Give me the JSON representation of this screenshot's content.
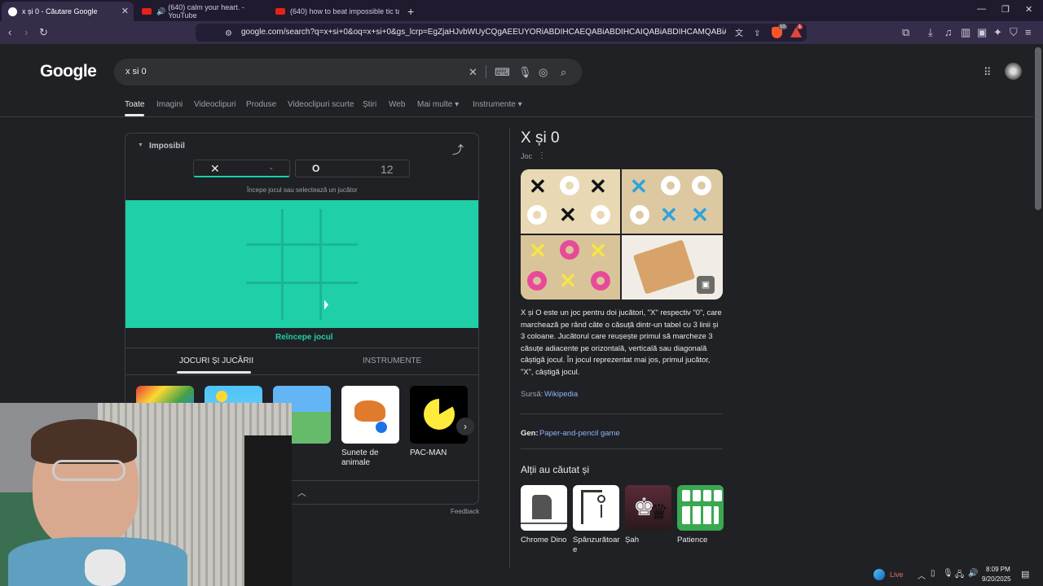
{
  "browser": {
    "tabs": [
      {
        "label": "x și 0 - Căutare Google",
        "active": true
      },
      {
        "label": "(640) calm your heart. - YouTube",
        "active": false
      },
      {
        "label": "(640) how to beat impossible tic tac t",
        "active": false
      }
    ],
    "new_tab": "+",
    "url": "google.com/search?q=x+si+0&oq=x+si+0&gs_lcrp=EgZjaHJvbWUyCQgAEEUYORiABDIHCAEQABiABDIHCAIQABiABDIHCAMQABiABDIGCAQQ...",
    "window_controls": [
      "—",
      "❐",
      "✕"
    ],
    "shield_badge": "10",
    "alert_badge": "1"
  },
  "google": {
    "logo": "Google",
    "query": "x si 0",
    "nav_tabs": [
      "Toate",
      "Imagini",
      "Videoclipuri",
      "Produse",
      "Videoclipuri scurte",
      "Știri",
      "Web",
      "Mai multe ▾",
      "Instrumente ▾"
    ]
  },
  "game": {
    "difficulty": "Imposibil",
    "x_symbol": "✕",
    "x_score": "-",
    "o_symbol": "O",
    "o_score": "12",
    "hint": "Începe jocul sau selectează un jucător",
    "restart": "Reîncepe jocul",
    "tabs": [
      "JOCURI ȘI JUCĂRII",
      "INSTRUMENTE"
    ],
    "tiles": [
      {
        "label": ""
      },
      {
        "label": ""
      },
      {
        "label": ""
      },
      {
        "label": "Sunete de animale"
      },
      {
        "label": "PAC-MAN"
      }
    ],
    "feedback": "Feedback"
  },
  "panel": {
    "title": "X și 0",
    "subtitle": "Joc",
    "description": "X și O este un joc pentru doi jucători, \"X\" respectiv \"0\", care marchează pe rând câte o căsuță dintr-un tabel cu 3 linii și 3 coloane. Jucătorul care reușește primul să marcheze 3 căsuțe adiacente pe orizontală, verticală sau diagonală câștigă jocul. În jocul reprezentat mai jos, primul jucător, \"X\", câștigă jocul.",
    "source_label": "Sursă:",
    "source_link": "Wikipedia",
    "genre_label": "Gen:",
    "genre_value": "Paper-and-pencil game",
    "also_title": "Alții au căutat și",
    "also": [
      "Chrome Dino",
      "Spânzurătoare",
      "Șah",
      "Patience"
    ]
  },
  "tray": {
    "live": "Live",
    "time": "8:09 PM",
    "date": "9/20/2025"
  },
  "colors": {
    "board": "#1fcfa7",
    "board_lines": "#1ab596",
    "accent_green": "#1fcfa7",
    "link": "#8ab4f8"
  }
}
